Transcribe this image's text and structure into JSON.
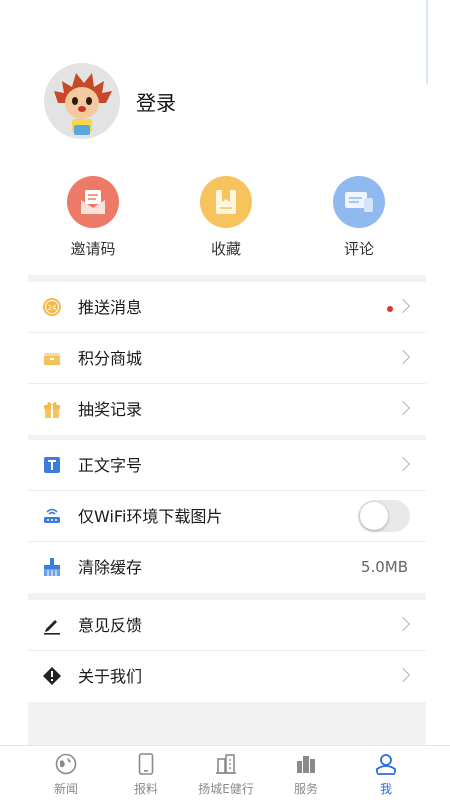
{
  "profile": {
    "login_label": "登录"
  },
  "quick_actions": [
    {
      "label": "邀请码",
      "color": "#ec7a66",
      "icon": "envelope-icon"
    },
    {
      "label": "收藏",
      "color": "#f6c35c",
      "icon": "bookmark-icon"
    },
    {
      "label": "评论",
      "color": "#8fb9ef",
      "icon": "comment-icon"
    }
  ],
  "menu": {
    "section1": [
      {
        "label": "推送消息",
        "icon": "push-24-icon",
        "has_dot": true
      },
      {
        "label": "积分商城",
        "icon": "shop-box-icon"
      },
      {
        "label": "抽奖记录",
        "icon": "gift-icon"
      }
    ],
    "section2": [
      {
        "label": "正文字号",
        "icon": "text-size-icon"
      },
      {
        "label": "仅WiFi环境下载图片",
        "icon": "router-icon",
        "toggle": false
      },
      {
        "label": "清除缓存",
        "icon": "broom-icon",
        "value": "5.0MB"
      }
    ],
    "section3": [
      {
        "label": "意见反馈",
        "icon": "pencil-icon"
      },
      {
        "label": "关于我们",
        "icon": "info-diamond-icon"
      }
    ]
  },
  "tabbar": {
    "active_color": "#2b6be0",
    "items": [
      {
        "label": "新闻",
        "icon": "globe-icon"
      },
      {
        "label": "报料",
        "icon": "phone-icon"
      },
      {
        "label": "扬城E健行",
        "icon": "buildings-icon"
      },
      {
        "label": "服务",
        "icon": "city-icon"
      },
      {
        "label": "我",
        "icon": "user-icon",
        "active": true
      }
    ]
  }
}
